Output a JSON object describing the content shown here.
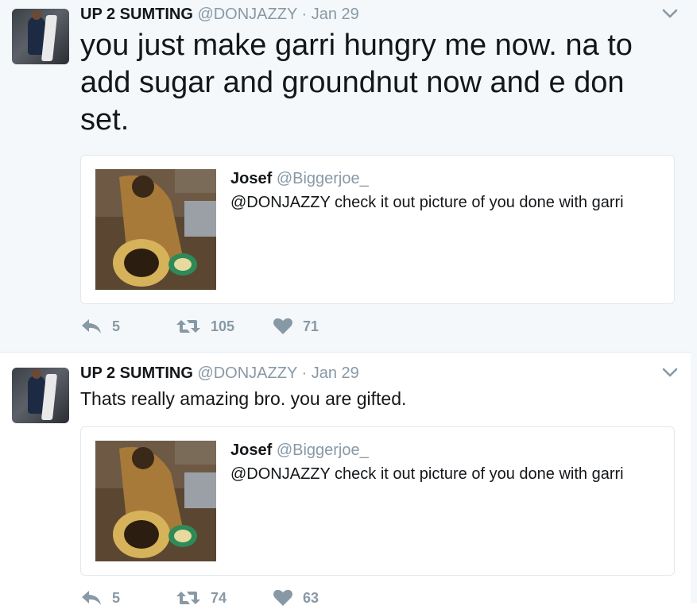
{
  "tweets": [
    {
      "author": {
        "name": "UP 2 SUMTING",
        "handle": "@DONJAZZY",
        "separator": "·",
        "date": "Jan 29"
      },
      "text": "you just make garri hungry me now. na to add sugar and groundnut now and e don set.",
      "quoted": {
        "name": "Josef",
        "handle": "@Biggerjoe_",
        "text": "@DONJAZZY check it out picture of you done with garri"
      },
      "actions": {
        "replies": "5",
        "retweets": "105",
        "likes": "71"
      }
    },
    {
      "author": {
        "name": "UP 2 SUMTING",
        "handle": "@DONJAZZY",
        "separator": "·",
        "date": "Jan 29"
      },
      "text": "Thats really amazing bro. you are gifted.",
      "quoted": {
        "name": "Josef",
        "handle": "@Biggerjoe_",
        "text": "@DONJAZZY check it out picture of you done with garri"
      },
      "actions": {
        "replies": "5",
        "retweets": "74",
        "likes": "63"
      }
    }
  ],
  "icons": [
    "reply-icon",
    "retweet-icon",
    "heart-icon",
    "chevron-down-icon"
  ],
  "colors": {
    "name": "#14171a",
    "muted": "#8899a6",
    "highlight_bg": "#f5f8fa",
    "border": "#e1e8ed"
  }
}
